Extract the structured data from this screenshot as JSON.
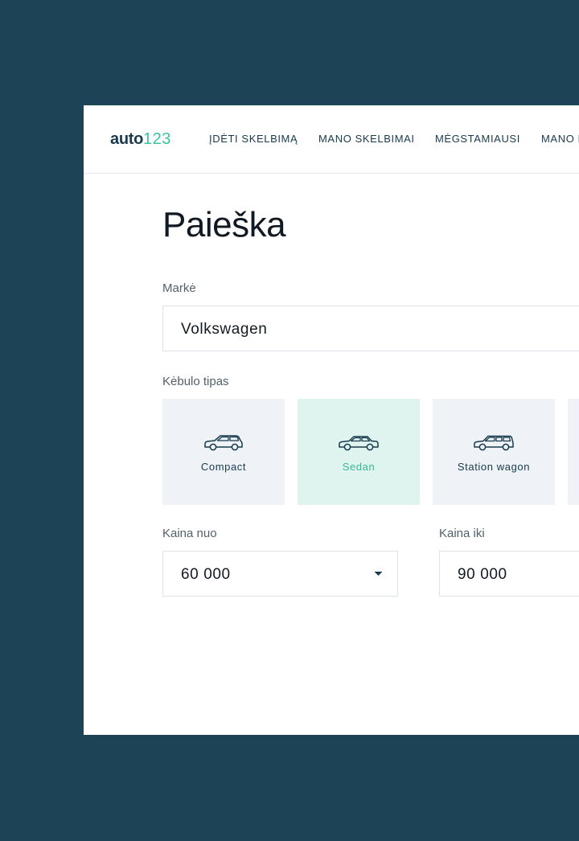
{
  "brand": {
    "name": "auto",
    "suffix": "123"
  },
  "nav": [
    {
      "label": "ĮDĖTI SKELBIMĄ"
    },
    {
      "label": "MANO SKELBIMAI"
    },
    {
      "label": "MĖGSTAMIAUSI"
    },
    {
      "label": "MANO P"
    }
  ],
  "page": {
    "title": "Paieška"
  },
  "make": {
    "label": "Markė",
    "value": "Volkswagen"
  },
  "body_type": {
    "label": "Kėbulo tipas",
    "options": [
      {
        "label": "Compact",
        "icon": "compact-car-icon",
        "selected": false
      },
      {
        "label": "Sedan",
        "icon": "sedan-car-icon",
        "selected": true
      },
      {
        "label": "Station wagon",
        "icon": "station-wagon-car-icon",
        "selected": false
      }
    ]
  },
  "price_from": {
    "label": "Kaina nuo",
    "value": "60 000"
  },
  "price_to": {
    "label": "Kaina iki",
    "value": "90 000"
  },
  "colors": {
    "background": "#1d4456",
    "accent": "#3cc4a0",
    "tile": "#eff2f7",
    "tile_selected": "#e0f4ef",
    "text_dark": "#173a4c"
  }
}
